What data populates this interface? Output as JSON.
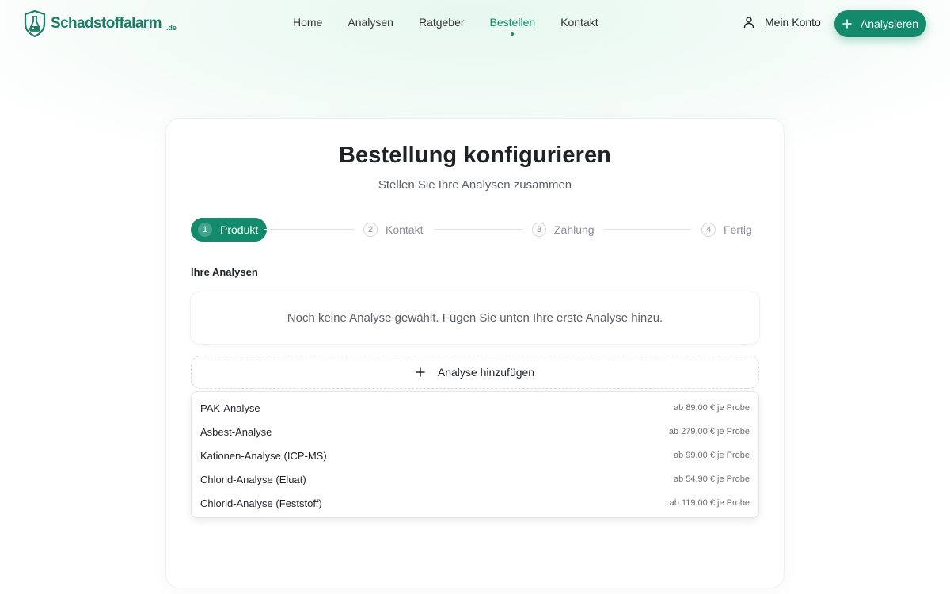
{
  "header": {
    "logo_text": "Schadstoffalarm",
    "logo_tld": ".de",
    "nav": [
      {
        "label": "Home"
      },
      {
        "label": "Analysen"
      },
      {
        "label": "Ratgeber"
      },
      {
        "label": "Bestellen",
        "active": true
      },
      {
        "label": "Kontakt"
      }
    ],
    "account_label": "Mein Konto",
    "cta_label": "Analysieren"
  },
  "card": {
    "title": "Bestellung konfigurieren",
    "subtitle": "Stellen Sie Ihre Analysen zusammen",
    "steps": [
      {
        "num": "1",
        "label": "Produkt",
        "active": true
      },
      {
        "num": "2",
        "label": "Kontakt"
      },
      {
        "num": "3",
        "label": "Zahlung"
      },
      {
        "num": "4",
        "label": "Fertig"
      }
    ],
    "section_label": "Ihre Analysen",
    "empty_text": "Noch keine Analyse gewählt. Fügen Sie unten Ihre erste Analyse hinzu.",
    "add_label": "Analyse hinzufügen",
    "options": [
      {
        "name": "PAK-Analyse",
        "price": "ab 89,00 € je Probe"
      },
      {
        "name": "Asbest-Analyse",
        "price": "ab 279,00 € je Probe"
      },
      {
        "name": "Kationen-Analyse (ICP-MS)",
        "price": "ab 99,00 € je Probe"
      },
      {
        "name": "Chlorid-Analyse (Eluat)",
        "price": "ab 54,90 € je Probe"
      },
      {
        "name": "Chlorid-Analyse (Feststoff)",
        "price": "ab 119,00 € je Probe"
      }
    ]
  },
  "colors": {
    "accent": "#138a6b",
    "brand": "#1a7f66"
  }
}
